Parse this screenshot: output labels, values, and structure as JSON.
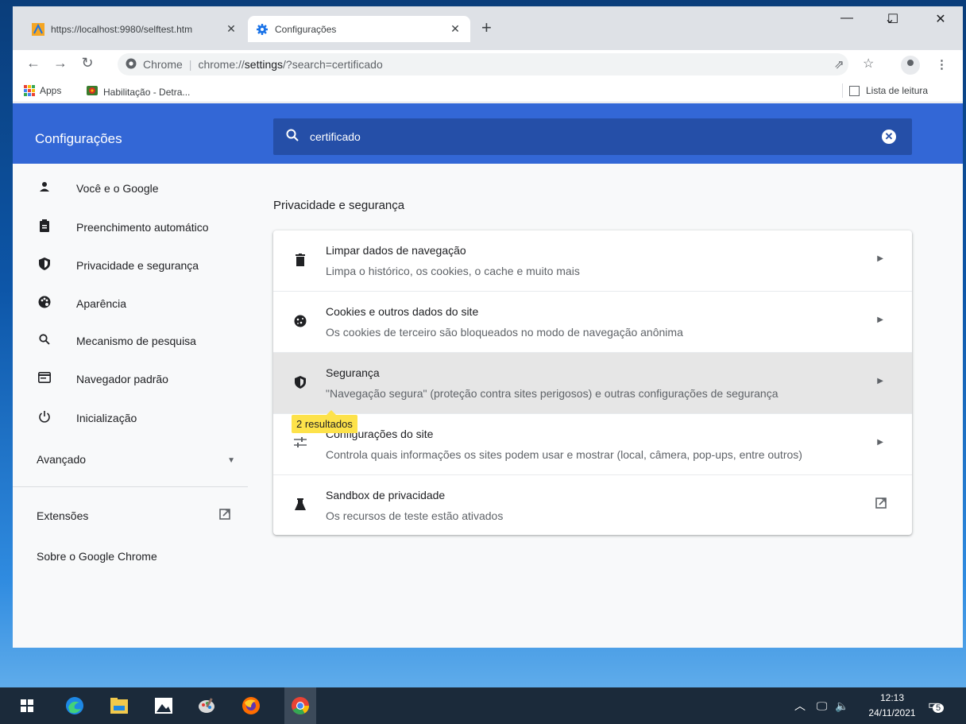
{
  "browser": {
    "tabs": [
      {
        "title": "https://localhost:9980/selftest.htm",
        "close": "✕"
      },
      {
        "title": "Configurações",
        "close": "✕"
      }
    ],
    "new_tab": "+",
    "window_controls": {
      "menu": "⌄",
      "minimize": "—",
      "maximize": "☐",
      "close": "✕"
    },
    "omnibox": {
      "site_label": "Chrome",
      "separator": "|",
      "url_scheme": "chrome://",
      "url_host": "settings",
      "url_rest": "/?search=certificado"
    },
    "bookmarks": [
      {
        "label": "Apps"
      },
      {
        "label": "Habilitação - Detra..."
      }
    ],
    "reading_list": "Lista de leitura"
  },
  "settings": {
    "header_title": "Configurações",
    "search_value": "certificado",
    "sidebar": {
      "items": [
        {
          "label": "Você e o Google",
          "icon": "person-icon"
        },
        {
          "label": "Preenchimento automático",
          "icon": "clipboard-icon"
        },
        {
          "label": "Privacidade e segurança",
          "icon": "shield-icon"
        },
        {
          "label": "Aparência",
          "icon": "palette-icon"
        },
        {
          "label": "Mecanismo de pesquisa",
          "icon": "search-icon"
        },
        {
          "label": "Navegador padrão",
          "icon": "browser-icon"
        },
        {
          "label": "Inicialização",
          "icon": "power-icon"
        }
      ],
      "advanced": "Avançado",
      "extensions": "Extensões",
      "about": "Sobre o Google Chrome"
    },
    "section_title": "Privacidade e segurança",
    "rows": [
      {
        "title": "Limpar dados de navegação",
        "subtitle": "Limpa o histórico, os cookies, o cache e muito mais",
        "icon": "trash-icon"
      },
      {
        "title": "Cookies e outros dados do site",
        "subtitle": "Os cookies de terceiro são bloqueados no modo de navegação anônima",
        "icon": "cookie-icon"
      },
      {
        "title": "Segurança",
        "subtitle": "\"Navegação segura\" (proteção contra sites perigosos) e outras configurações de segurança",
        "icon": "shield-icon"
      },
      {
        "title": "Configurações do site",
        "subtitle": "Controla quais informações os sites podem usar e mostrar (local, câmera, pop-ups, entre outros)",
        "icon": "tune-icon"
      },
      {
        "title": "Sandbox de privacidade",
        "subtitle": "Os recursos de teste estão ativados",
        "icon": "flask-icon"
      }
    ],
    "search_bubble": "2 resultados"
  },
  "taskbar": {
    "time": "12:13",
    "date": "24/11/2021",
    "notification_count": "5"
  },
  "colors": {
    "header": "#3367d6",
    "search": "#254fa8",
    "bubble": "#fde24a"
  }
}
